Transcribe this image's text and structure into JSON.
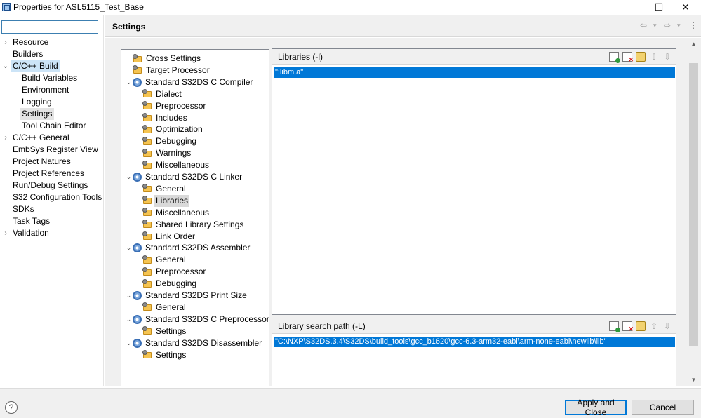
{
  "window": {
    "title": "Properties for ASL5115_Test_Base",
    "minimize_glyph": "—",
    "maximize_glyph": "☐",
    "close_glyph": "✕"
  },
  "filter": {
    "value": "",
    "placeholder": ""
  },
  "nav": {
    "items": [
      {
        "label": "Resource",
        "twisty": "›"
      },
      {
        "label": "Builders"
      },
      {
        "label": "C/C++ Build",
        "twisty": "⌄"
      },
      {
        "label": "Build Variables"
      },
      {
        "label": "Environment"
      },
      {
        "label": "Logging"
      },
      {
        "label": "Settings"
      },
      {
        "label": "Tool Chain Editor"
      },
      {
        "label": "C/C++ General",
        "twisty": "›"
      },
      {
        "label": "EmbSys Register View"
      },
      {
        "label": "Project Natures"
      },
      {
        "label": "Project References"
      },
      {
        "label": "Run/Debug Settings"
      },
      {
        "label": "S32 Configuration Tools"
      },
      {
        "label": "SDKs"
      },
      {
        "label": "Task Tags"
      },
      {
        "label": "Validation",
        "twisty": "›"
      }
    ]
  },
  "header": {
    "title": "Settings",
    "back_glyph": "⇦",
    "back_menu_glyph": "▾",
    "forward_glyph": "⇨",
    "forward_menu_glyph": "▾",
    "more_glyph": "⋮"
  },
  "tree": {
    "items": [
      {
        "label": "Cross Settings"
      },
      {
        "label": "Target Processor"
      },
      {
        "label": "Standard S32DS C Compiler"
      },
      {
        "label": "Dialect"
      },
      {
        "label": "Preprocessor"
      },
      {
        "label": "Includes"
      },
      {
        "label": "Optimization"
      },
      {
        "label": "Debugging"
      },
      {
        "label": "Warnings"
      },
      {
        "label": "Miscellaneous"
      },
      {
        "label": "Standard S32DS C Linker"
      },
      {
        "label": "General"
      },
      {
        "label": "Libraries"
      },
      {
        "label": "Miscellaneous"
      },
      {
        "label": "Shared Library Settings"
      },
      {
        "label": "Link Order"
      },
      {
        "label": "Standard S32DS Assembler"
      },
      {
        "label": "General"
      },
      {
        "label": "Preprocessor"
      },
      {
        "label": "Debugging"
      },
      {
        "label": "Standard S32DS Print Size"
      },
      {
        "label": "General"
      },
      {
        "label": "Standard S32DS C Preprocessor"
      },
      {
        "label": "Settings"
      },
      {
        "label": "Standard S32DS Disassembler"
      },
      {
        "label": "Settings"
      }
    ]
  },
  "libraries": {
    "title": "Libraries (-l)",
    "entries": [
      "\":libm.a\""
    ]
  },
  "search_paths": {
    "title": "Library search path (-L)",
    "entries": [
      "\"C:\\NXP\\S32DS.3.4\\S32DS\\build_tools\\gcc_b1620\\gcc-6.3-arm32-eabi\\arm-none-eabi\\newlib\\lib\""
    ]
  },
  "scroll": {
    "up_glyph": "▲",
    "down_glyph": "▼"
  },
  "buttons": {
    "help": "?",
    "apply_close": "Apply and Close",
    "cancel": "Cancel"
  }
}
